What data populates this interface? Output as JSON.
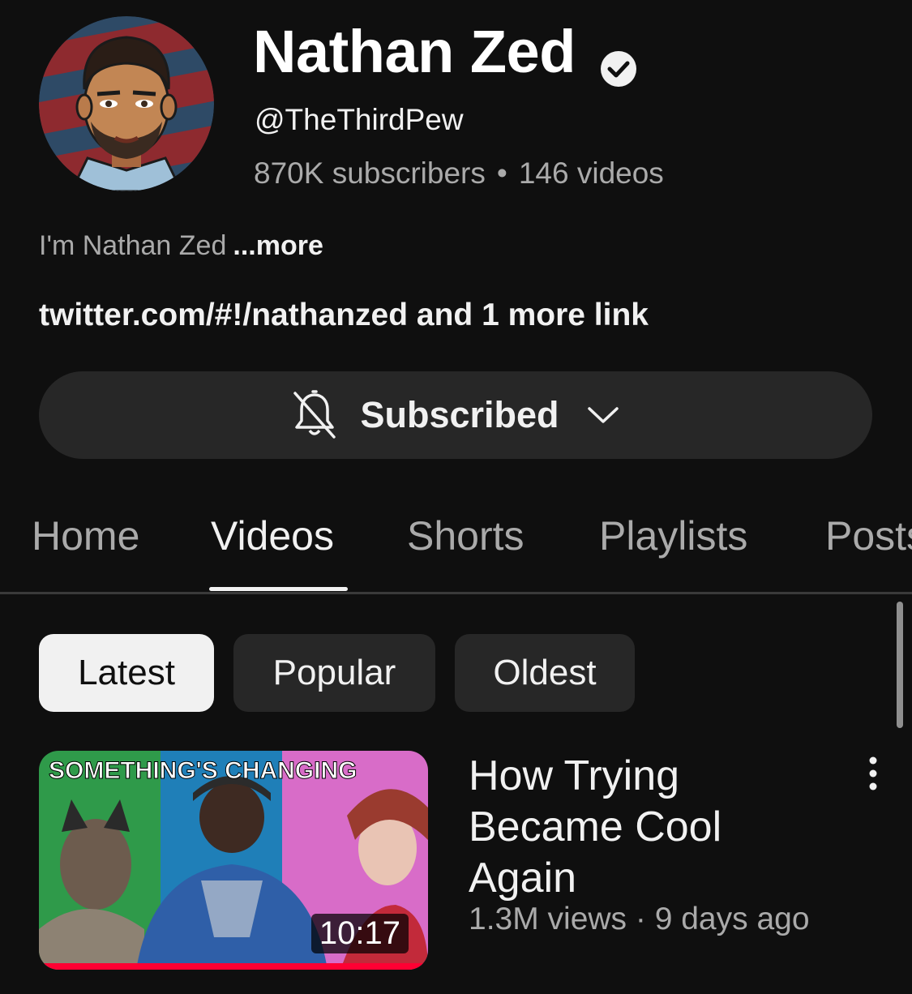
{
  "channel": {
    "name": "Nathan Zed",
    "handle": "@TheThirdPew",
    "subscribers": "870K subscribers",
    "separator": "•",
    "videos": "146 videos",
    "description": "I'm Nathan Zed",
    "more_label": "...more",
    "links": "twitter.com/#!/nathanzed and 1 more link"
  },
  "subscribe_button": {
    "label": "Subscribed",
    "bell_icon": "notifications-off-icon",
    "chevron_icon": "chevron-down-icon"
  },
  "tabs": [
    {
      "label": "Home",
      "active": false
    },
    {
      "label": "Videos",
      "active": true
    },
    {
      "label": "Shorts",
      "active": false
    },
    {
      "label": "Playlists",
      "active": false
    },
    {
      "label": "Posts",
      "active": false
    }
  ],
  "chips": [
    {
      "label": "Latest",
      "active": true
    },
    {
      "label": "Popular",
      "active": false
    },
    {
      "label": "Oldest",
      "active": false
    }
  ],
  "videos": [
    {
      "thumbnail_text": "SOMETHING'S CHANGING",
      "duration": "10:17",
      "progress": 1.0,
      "title": "How Trying Became Cool Again",
      "meta": "1.3M views · 9 days ago"
    }
  ],
  "colors": {
    "background": "#0f0f0f",
    "accent": "#ff0033",
    "chip_bg": "#272727"
  }
}
